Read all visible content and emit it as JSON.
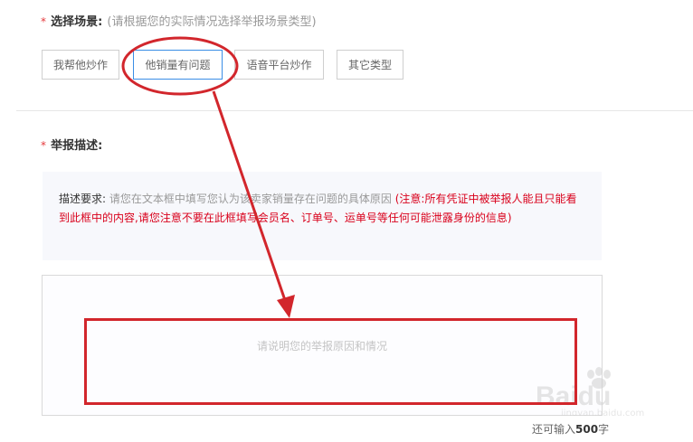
{
  "scene": {
    "label": "选择场景:",
    "hint": "(请根据您的实际情况选择举报场景类型)",
    "options": [
      {
        "label": "我帮他炒作",
        "selected": false
      },
      {
        "label": "他销量有问题",
        "selected": true
      },
      {
        "label": "语音平台炒作",
        "selected": false
      },
      {
        "label": "其它类型",
        "selected": false
      }
    ]
  },
  "report": {
    "label": "举报描述:",
    "desc_label": "描述要求:",
    "desc_grey": "请您在文本框中填写您认为该卖家销量存在问题的具体原因",
    "desc_red": "(注意:所有凭证中被举报人能且只能看到此框中的内容,请您注意不要在此框填写会员名、订单号、运单号等任何可能泄露身份的信息)",
    "placeholder": "请说明您的举报原因和情况",
    "counter_prefix": "还可输入",
    "counter_value": "500",
    "counter_suffix": "字"
  },
  "required_mark": "*",
  "watermark": {
    "text": "Baidu",
    "sub": "jingyan.baidu.com"
  },
  "colors": {
    "annotation": "#d2262c",
    "selected_border": "#3a8ee6",
    "required": "#e4393c"
  }
}
